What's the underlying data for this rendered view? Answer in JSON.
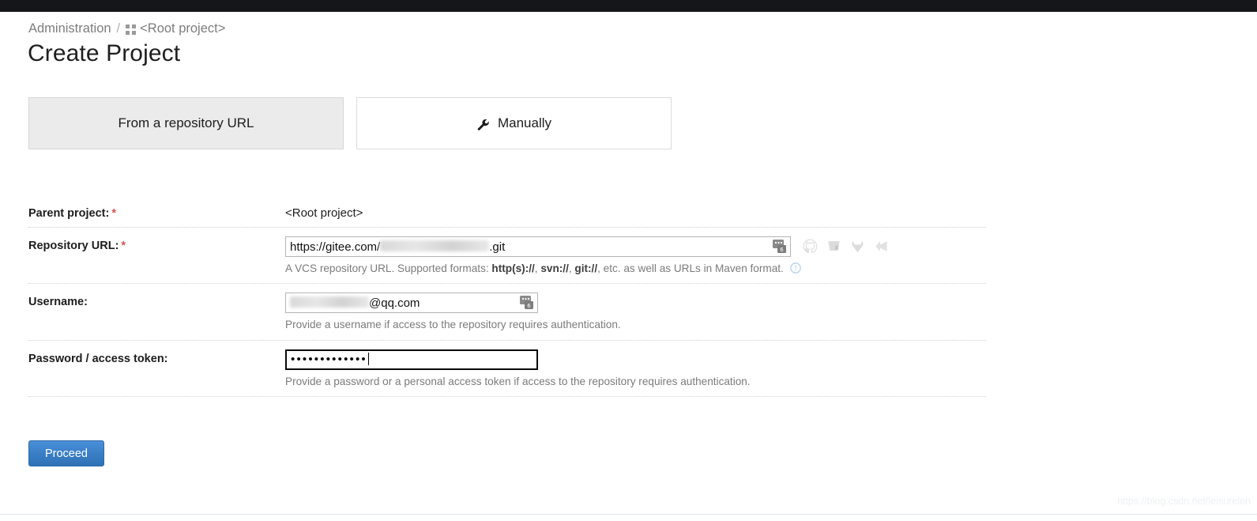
{
  "breadcrumb": {
    "root_label": "Administration",
    "separator": "/",
    "project_icon": "grid-icon",
    "project_label": "<Root project>"
  },
  "page_title": "Create Project",
  "tabs": [
    {
      "label": "From a repository URL",
      "selected": true,
      "icon": null
    },
    {
      "label": "Manually",
      "selected": false,
      "icon": "wrench-icon"
    }
  ],
  "form": {
    "parent_project": {
      "label": "Parent project:",
      "required_marker": "*",
      "value": "<Root project>"
    },
    "repository_url": {
      "label": "Repository URL:",
      "required_marker": "*",
      "value_prefix": "https://gitee.com/",
      "value_suffix": ".git",
      "value_redacted": true,
      "field_icon": "password-manager-icon",
      "hint_before": "A VCS repository URL. Supported formats: ",
      "hint_bold_1": "http(s)://",
      "hint_mid_1": ", ",
      "hint_bold_2": "svn://",
      "hint_mid_2": ", ",
      "hint_bold_3": "git://",
      "hint_after": ", etc. as well as URLs in Maven format.",
      "help_icon": "question-circle-icon",
      "vcs_icons": [
        "github-icon",
        "bitbucket-icon",
        "gitlab-icon",
        "azure-devops-icon"
      ]
    },
    "username": {
      "label": "Username:",
      "required_marker": "",
      "value_suffix": "@qq.com",
      "value_redacted": true,
      "field_icon": "password-manager-icon",
      "hint": "Provide a username if access to the repository requires authentication."
    },
    "password": {
      "label": "Password / access token:",
      "required_marker": "",
      "value_masked": "•••••••••••••",
      "focused": true,
      "hint": "Provide a password or a personal access token if access to the repository requires authentication."
    }
  },
  "actions": {
    "proceed_label": "Proceed"
  },
  "watermark": "https://blog.csdn.net/leisurelen",
  "colors": {
    "topbar": "#141619",
    "accent_button": "#3a7fc6",
    "required_asterisk": "#d9534f",
    "selected_tab_bg": "#ebebeb"
  }
}
